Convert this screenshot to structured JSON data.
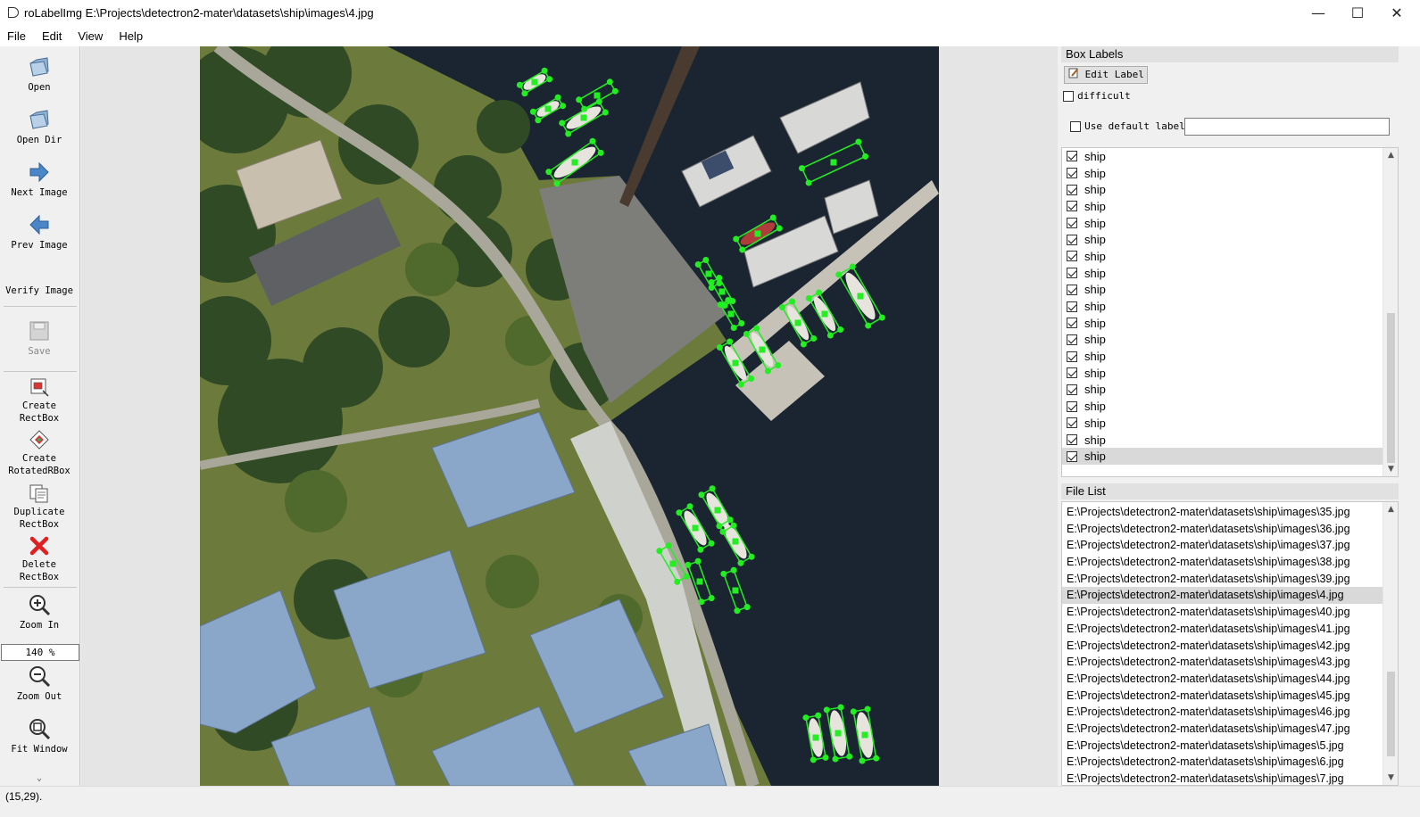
{
  "window": {
    "title": "roLabelImg E:\\Projects\\detectron2-mater\\datasets\\ship\\images\\4.jpg",
    "minimize": "—",
    "maximize": "☐",
    "close": "✕"
  },
  "menu": [
    "File",
    "Edit",
    "View",
    "Help"
  ],
  "toolbar": {
    "open": "Open",
    "open_dir": "Open Dir",
    "next_image": "Next Image",
    "prev_image": "Prev Image",
    "verify_image": "Verify Image",
    "save": "Save",
    "create_rectbox_1": "Create",
    "create_rectbox_2": "RectBox",
    "create_rotated_1": "Create",
    "create_rotated_2": "RotatedRBox",
    "duplicate_1": "Duplicate",
    "duplicate_2": "RectBox",
    "delete_1": "Delete",
    "delete_2": "RectBox",
    "zoom_in": "Zoom In",
    "zoom_value": "140 %",
    "zoom_out": "Zoom Out",
    "fit_window": "Fit Window",
    "more": "⌄"
  },
  "box_labels": {
    "header": "Box Labels",
    "edit_label": "Edit Label",
    "difficult": "difficult",
    "use_default_label": "Use default label",
    "default_label_value": "",
    "labels": [
      "ship",
      "ship",
      "ship",
      "ship",
      "ship",
      "ship",
      "ship",
      "ship",
      "ship",
      "ship",
      "ship",
      "ship",
      "ship",
      "ship",
      "ship",
      "ship",
      "ship",
      "ship",
      "ship"
    ],
    "selected_index": 18
  },
  "file_list": {
    "header": "File List",
    "files": [
      "E:\\Projects\\detectron2-mater\\datasets\\ship\\images\\35.jpg",
      "E:\\Projects\\detectron2-mater\\datasets\\ship\\images\\36.jpg",
      "E:\\Projects\\detectron2-mater\\datasets\\ship\\images\\37.jpg",
      "E:\\Projects\\detectron2-mater\\datasets\\ship\\images\\38.jpg",
      "E:\\Projects\\detectron2-mater\\datasets\\ship\\images\\39.jpg",
      "E:\\Projects\\detectron2-mater\\datasets\\ship\\images\\4.jpg",
      "E:\\Projects\\detectron2-mater\\datasets\\ship\\images\\40.jpg",
      "E:\\Projects\\detectron2-mater\\datasets\\ship\\images\\41.jpg",
      "E:\\Projects\\detectron2-mater\\datasets\\ship\\images\\42.jpg",
      "E:\\Projects\\detectron2-mater\\datasets\\ship\\images\\43.jpg",
      "E:\\Projects\\detectron2-mater\\datasets\\ship\\images\\44.jpg",
      "E:\\Projects\\detectron2-mater\\datasets\\ship\\images\\45.jpg",
      "E:\\Projects\\detectron2-mater\\datasets\\ship\\images\\46.jpg",
      "E:\\Projects\\detectron2-mater\\datasets\\ship\\images\\47.jpg",
      "E:\\Projects\\detectron2-mater\\datasets\\ship\\images\\5.jpg",
      "E:\\Projects\\detectron2-mater\\datasets\\ship\\images\\6.jpg",
      "E:\\Projects\\detectron2-mater\\datasets\\ship\\images\\7.jpg"
    ],
    "selected_index": 5
  },
  "status": "(15,29).",
  "colors": {
    "annotation": "#22ee22",
    "water": "#1a2430",
    "grass": "#6f7a3a",
    "roof": "#8aa6c8"
  }
}
